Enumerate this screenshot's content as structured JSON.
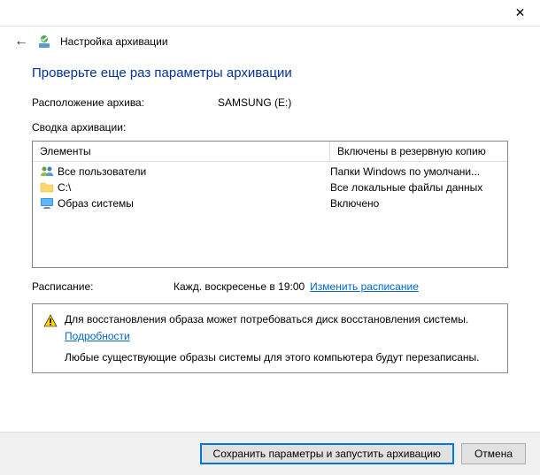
{
  "titlebar": {
    "close": "✕"
  },
  "header": {
    "back": "←",
    "title": "Настройка архивации"
  },
  "heading": "Проверьте еще раз параметры архивации",
  "location": {
    "label": "Расположение архива:",
    "value": "SAMSUNG (E:)"
  },
  "summary": {
    "label": "Сводка архивации:",
    "columns": {
      "elements": "Элементы",
      "included": "Включены в резервную копию"
    },
    "rows": [
      {
        "icon": "users",
        "name": "Все пользователи",
        "included": "Папки Windows по умолчани..."
      },
      {
        "icon": "folder",
        "name": "C:\\",
        "included": "Все локальные файлы данных"
      },
      {
        "icon": "monitor",
        "name": "Образ системы",
        "included": "Включено"
      }
    ]
  },
  "schedule": {
    "label": "Расписание:",
    "value": "Кажд. воскресенье в 19:00",
    "link": "Изменить расписание"
  },
  "info": {
    "line1": "Для восстановления образа может потребоваться диск восстановления системы.",
    "details_link": "Подробности",
    "line2": "Любые существующие образы системы для этого компьютера будут перезаписаны."
  },
  "footer": {
    "save": "Сохранить параметры и запустить архивацию",
    "cancel": "Отмена"
  }
}
